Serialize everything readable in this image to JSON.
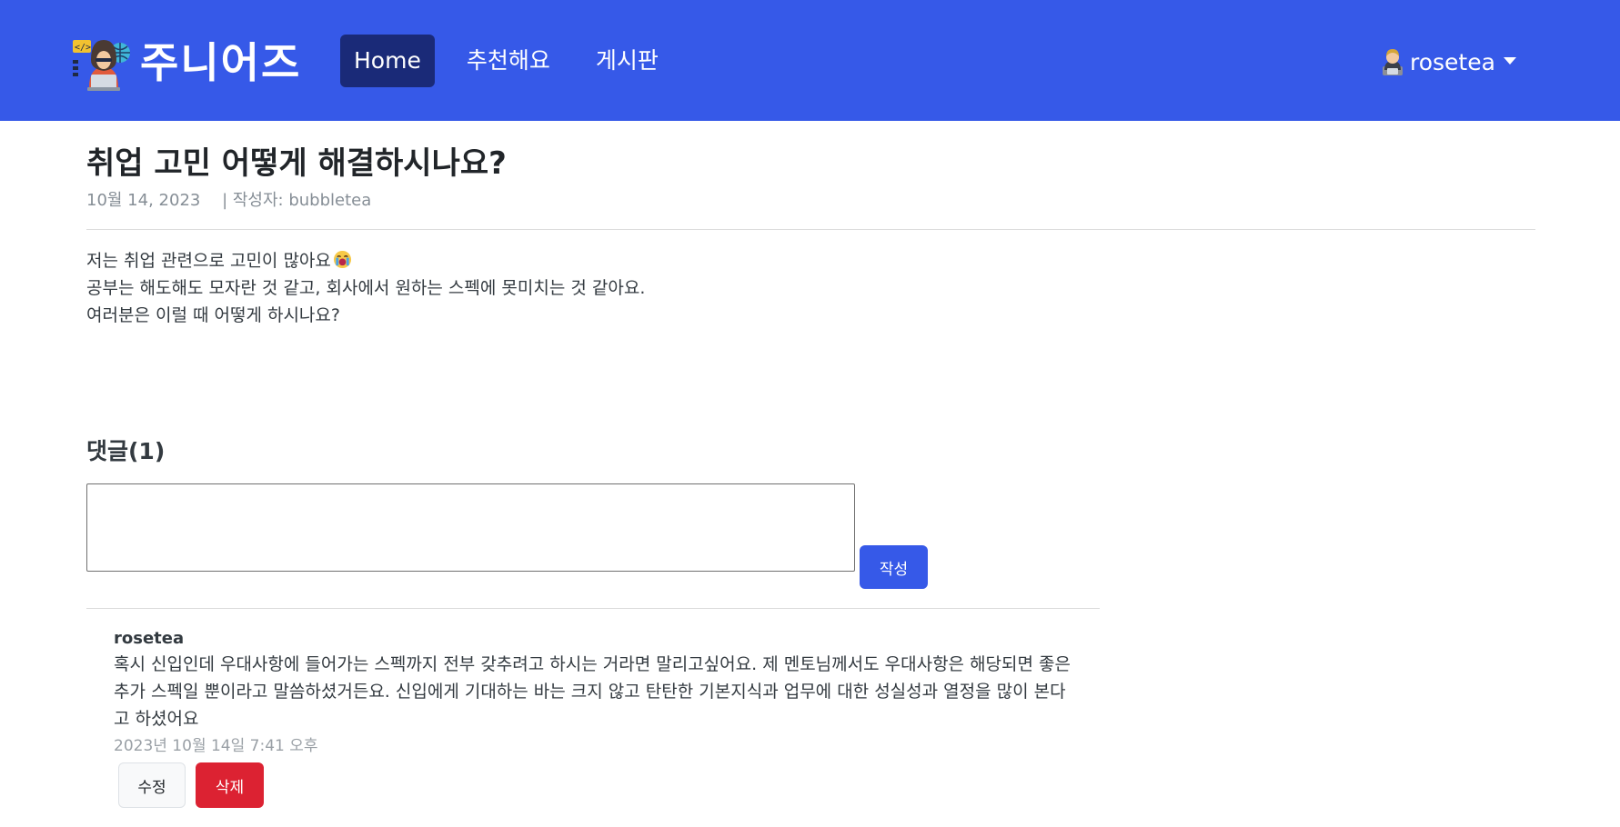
{
  "brand": {
    "name": "주니어즈",
    "logo_icon": "hacker-coder-icon"
  },
  "nav": {
    "items": [
      {
        "label": "Home",
        "active": true
      },
      {
        "label": "추천해요",
        "active": false
      },
      {
        "label": "게시판",
        "active": false
      }
    ]
  },
  "user": {
    "name": "rosetea",
    "avatar_icon": "user-avatar-icon",
    "dropdown_icon": "caret-down-icon"
  },
  "post": {
    "title": "취업 고민 어떻게 해결하시나요?",
    "date": "10월 14, 2023",
    "author_label": "| 작성자: bubbletea",
    "body_lines": [
      "저는 취업 관련으로 고민이 많아요",
      "공부는 해도해도 모자란 것 같고, 회사에서 원하는 스펙에 못미치는 것 같아요.",
      "여러분은 이럴 때 어떻게 하시나요?"
    ],
    "emoji_icon": "crying-face-emoji-icon"
  },
  "comments": {
    "heading": "댓글(1)",
    "input_value": "",
    "input_placeholder": "",
    "submit_label": "작성",
    "items": [
      {
        "author": "rosetea",
        "text": "혹시 신입인데 우대사항에 들어가는 스펙까지 전부 갖추려고 하시는 거라면 말리고싶어요. 제 멘토님께서도 우대사항은 해당되면 좋은 추가 스펙일 뿐이라고 말씀하셨거든요. 신입에게 기대하는 바는 크지 않고 탄탄한 기본지식과 업무에 대한 성실성과 열정을 많이 본다고 하셨어요",
        "time": "2023년 10월 14일 7:41 오후",
        "edit_label": "수정",
        "delete_label": "삭제"
      }
    ]
  },
  "colors": {
    "navbar": "#3659e8",
    "nav_active": "#1a2a78",
    "primary_button": "#3659e8",
    "danger_button": "#dc2232",
    "muted_text": "#868e96"
  }
}
